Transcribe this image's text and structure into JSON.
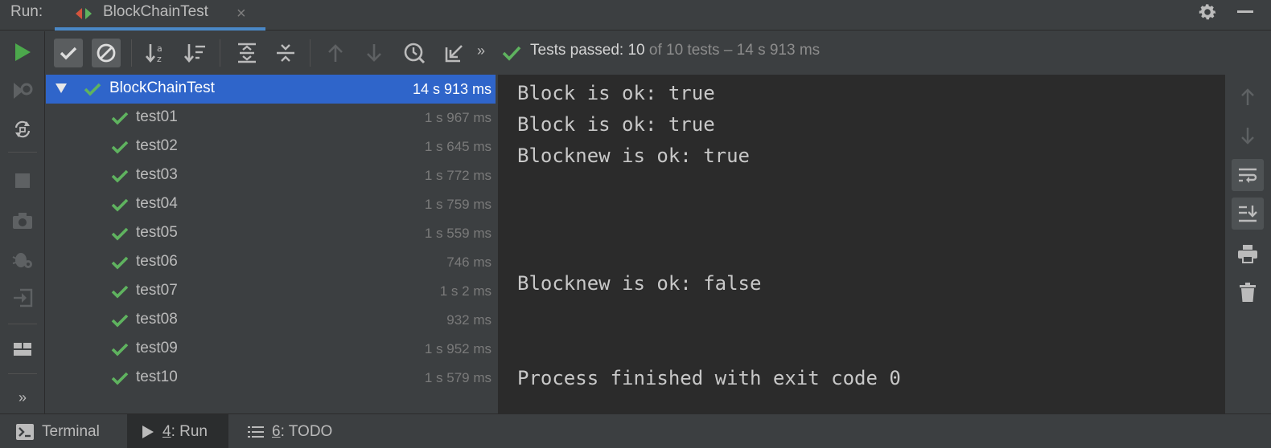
{
  "topbar": {
    "run_label": "Run:",
    "tab_title": "BlockChainTest",
    "tab_close": "×"
  },
  "toolbar": {
    "more": "»",
    "status_prefix": "Tests passed:",
    "status_passed": "10",
    "status_rest": "of 10 tests – 14 s 913 ms"
  },
  "tree": {
    "root": {
      "name": "BlockChainTest",
      "time": "14 s 913 ms"
    },
    "tests": [
      {
        "name": "test01",
        "time": "1 s 967 ms"
      },
      {
        "name": "test02",
        "time": "1 s 645 ms"
      },
      {
        "name": "test03",
        "time": "1 s 772 ms"
      },
      {
        "name": "test04",
        "time": "1 s 759 ms"
      },
      {
        "name": "test05",
        "time": "1 s 559 ms"
      },
      {
        "name": "test06",
        "time": "746 ms"
      },
      {
        "name": "test07",
        "time": "1 s 2 ms"
      },
      {
        "name": "test08",
        "time": "932 ms"
      },
      {
        "name": "test09",
        "time": "1 s 952 ms"
      },
      {
        "name": "test10",
        "time": "1 s 579 ms"
      }
    ]
  },
  "console": {
    "lines": [
      "Block is ok: true",
      "Block is ok: true",
      "Blocknew is ok: true",
      "Blocknew is ok: false",
      "Process finished with exit code 0"
    ]
  },
  "lefttool": {
    "more": "»"
  },
  "bottom": {
    "terminal": "Terminal",
    "run_mnemonic": "4",
    "run_label": ": Run",
    "todo_mnemonic": "6",
    "todo_label": ": TODO"
  },
  "colors": {
    "accent_blue": "#2f65ca",
    "pass_green": "#5fb35f",
    "run_green": "#4ca84c"
  }
}
